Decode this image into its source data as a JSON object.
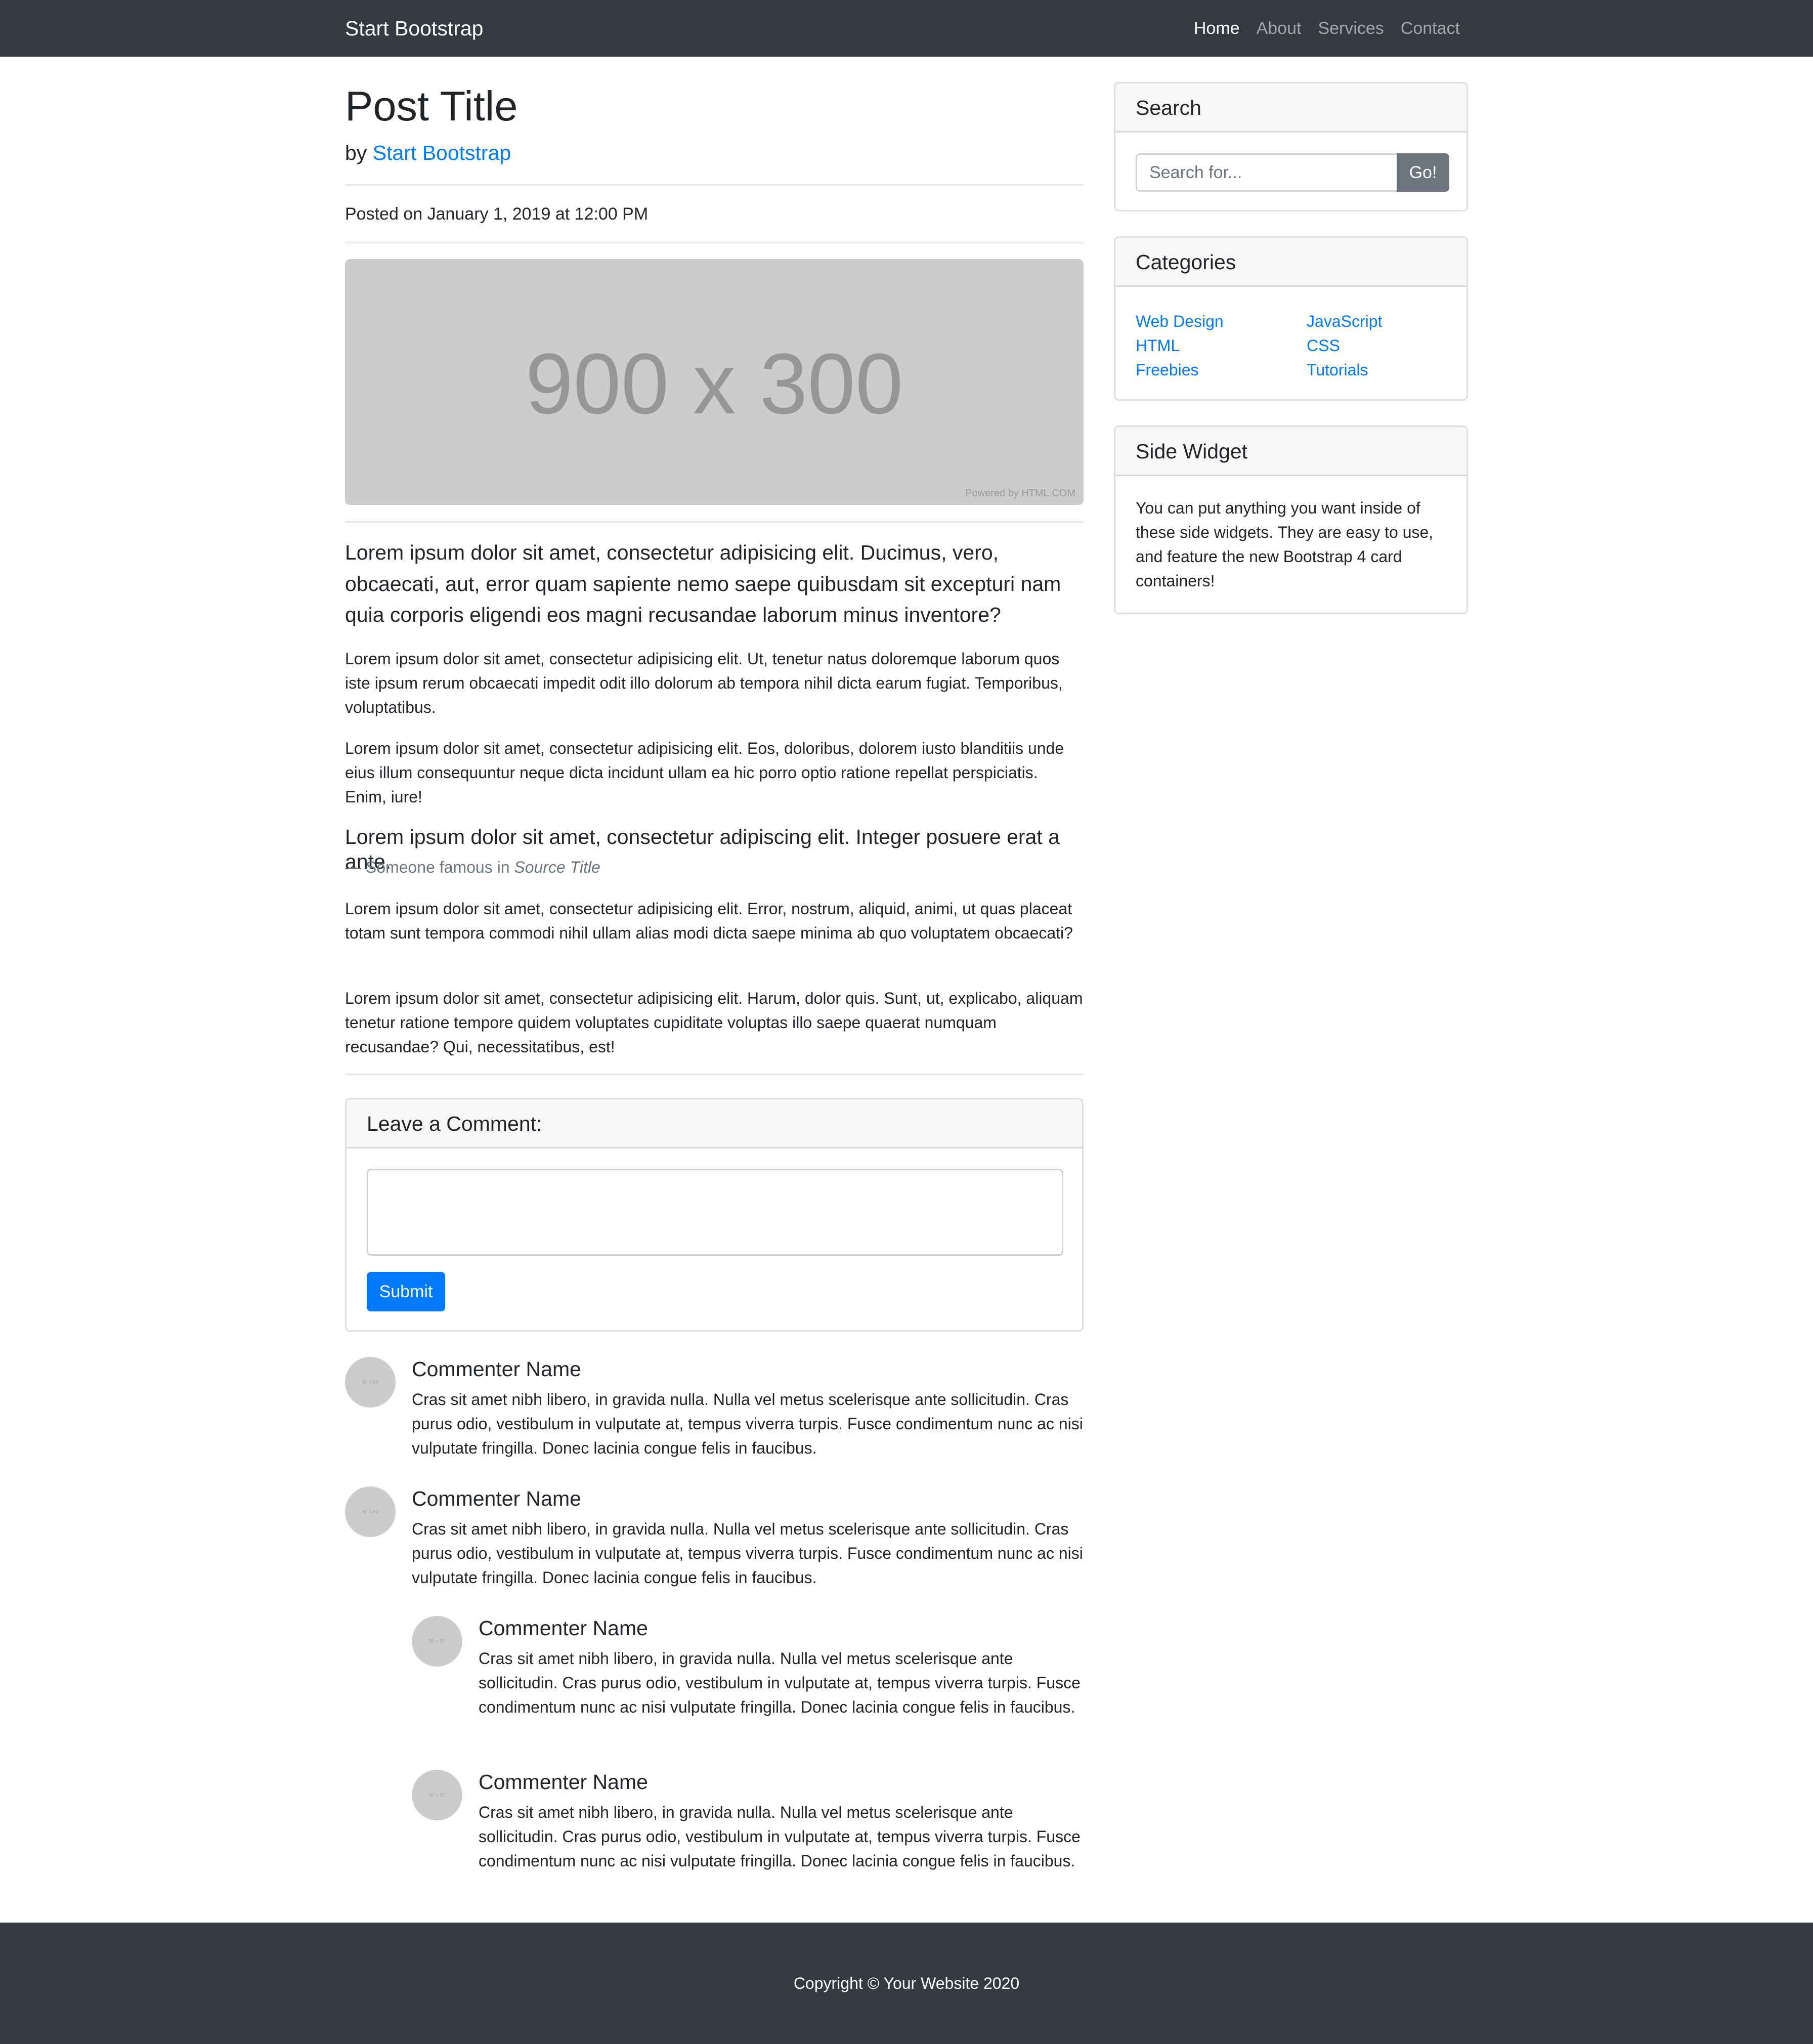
{
  "navbar": {
    "brand": "Start Bootstrap",
    "links": [
      "Home",
      "About",
      "Services",
      "Contact"
    ],
    "active_index": 0
  },
  "post": {
    "title": "Post Title",
    "by": "by",
    "author": "Start Bootstrap",
    "posted": "Posted on January 1, 2019 at 12:00 PM",
    "image": {
      "label": "900 x 300",
      "powered": "Powered by HTML.COM"
    },
    "lead": "Lorem ipsum dolor sit amet, consectetur adipisicing elit. Ducimus, vero, obcaecati, aut, error quam sapiente nemo saepe quibusdam sit excepturi nam quia corporis eligendi eos magni recusandae laborum minus inventore?",
    "paragraphs": [
      "Lorem ipsum dolor sit amet, consectetur adipisicing elit. Ut, tenetur natus doloremque laborum quos iste ipsum rerum obcaecati impedit odit illo dolorum ab tempora nihil dicta earum fugiat. Temporibus, voluptatibus.",
      "Lorem ipsum dolor sit amet, consectetur adipisicing elit. Eos, doloribus, dolorem iusto blanditiis unde eius illum consequuntur neque dicta incidunt ullam ea hic porro optio ratione repellat perspiciatis. Enim, iure!",
      "Lorem ipsum dolor sit amet, consectetur adipisicing elit. Error, nostrum, aliquid, animi, ut quas placeat totam sunt tempora commodi nihil ullam alias modi dicta saepe minima ab quo voluptatem obcaecati?",
      "Lorem ipsum dolor sit amet, consectetur adipisicing elit. Harum, dolor quis. Sunt, ut, explicabo, aliquam tenetur ratione tempore quidem voluptates cupiditate voluptas illo saepe quaerat numquam recusandae? Qui, necessitatibus, est!"
    ],
    "blockquote": {
      "text": "Lorem ipsum dolor sit amet, consectetur adipiscing elit. Integer posuere erat a ante.",
      "footer_prefix": "— Someone famous in ",
      "source": "Source Title"
    }
  },
  "comment_form": {
    "title": "Leave a Comment:",
    "textarea_value": "",
    "submit_label": "Submit"
  },
  "comments": [
    {
      "name": "Commenter Name",
      "text": "Cras sit amet nibh libero, in gravida nulla. Nulla vel metus scelerisque ante sollicitudin. Cras purus odio, vestibulum in vulputate at, tempus viverra turpis. Fusce condimentum nunc ac nisi vulputate fringilla. Donec lacinia congue felis in faucibus.",
      "avatar": "50 x 50"
    },
    {
      "name": "Commenter Name",
      "text": "Cras sit amet nibh libero, in gravida nulla. Nulla vel metus scelerisque ante sollicitudin. Cras purus odio, vestibulum in vulputate at, tempus viverra turpis. Fusce condimentum nunc ac nisi vulputate fringilla. Donec lacinia congue felis in faucibus.",
      "avatar": "50 x 50",
      "replies": [
        {
          "name": "Commenter Name",
          "text": "Cras sit amet nibh libero, in gravida nulla. Nulla vel metus scelerisque ante sollicitudin. Cras purus odio, vestibulum in vulputate at, tempus viverra turpis. Fusce condimentum nunc ac nisi vulputate fringilla. Donec lacinia congue felis in faucibus.",
          "avatar": "50 x 50"
        },
        {
          "name": "Commenter Name",
          "text": "Cras sit amet nibh libero, in gravida nulla. Nulla vel metus scelerisque ante sollicitudin. Cras purus odio, vestibulum in vulputate at, tempus viverra turpis. Fusce condimentum nunc ac nisi vulputate fringilla. Donec lacinia congue felis in faucibus.",
          "avatar": "50 x 50"
        }
      ]
    }
  ],
  "sidebar": {
    "search": {
      "title": "Search",
      "placeholder": "Search for...",
      "button": "Go!"
    },
    "categories": {
      "title": "Categories",
      "left": [
        "Web Design",
        "HTML",
        "Freebies"
      ],
      "right": [
        "JavaScript",
        "CSS",
        "Tutorials"
      ]
    },
    "widget": {
      "title": "Side Widget",
      "text": "You can put anything you want inside of these side widgets. They are easy to use, and feature the new Bootstrap 4 card containers!"
    }
  },
  "footer": {
    "copyright": "Copyright © Your Website 2020"
  },
  "colors": {
    "navbar_bg": "#343a40",
    "link": "#007bff",
    "primary_button": "#007bff",
    "secondary_button": "#6c757d",
    "placeholder_bg": "#cccccc",
    "card_header_bg": "#f7f7f7"
  }
}
